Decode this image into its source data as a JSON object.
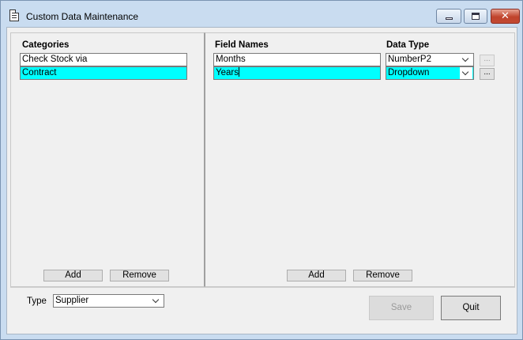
{
  "window": {
    "title": "Custom Data Maintenance",
    "close_glyph": "✕"
  },
  "categories": {
    "header": "Categories",
    "items": [
      "Check Stock via",
      "Contract"
    ],
    "selected_index": 1,
    "add_label": "Add",
    "remove_label": "Remove"
  },
  "fields": {
    "name_header": "Field Names",
    "type_header": "Data Type",
    "rows": [
      {
        "name": "Months",
        "type": "NumberP2",
        "ellipsis": "...",
        "ellipsis_enabled": false
      },
      {
        "name": "Years",
        "type": "Dropdown",
        "ellipsis": "...",
        "ellipsis_enabled": true
      }
    ],
    "selected_index": 1,
    "add_label": "Add",
    "remove_label": "Remove"
  },
  "footer": {
    "type_label": "Type",
    "type_value": "Supplier",
    "save_label": "Save",
    "save_enabled": false,
    "quit_label": "Quit"
  },
  "colors": {
    "selection": "#00ffff",
    "frame": "#c9dcf0"
  }
}
